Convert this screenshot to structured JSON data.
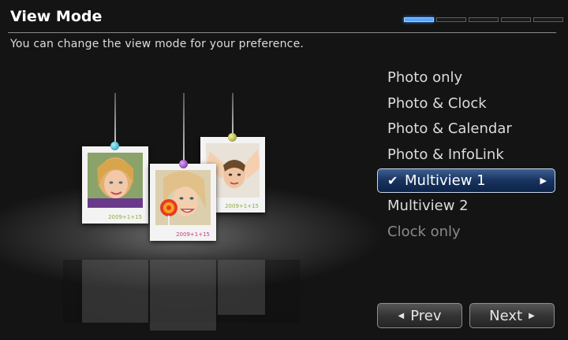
{
  "header": {
    "title": "View Mode",
    "subtitle": "You can change the view mode for your preference.",
    "steps_total": 5,
    "step_active": 1
  },
  "preview": {
    "photos": [
      {
        "caption": "2009+1+15"
      },
      {
        "caption": "2009+1+15"
      },
      {
        "caption": "2009+1+15"
      }
    ]
  },
  "menu": {
    "items": [
      {
        "label": "Photo only",
        "state": "normal"
      },
      {
        "label": "Photo & Clock",
        "state": "normal"
      },
      {
        "label": "Photo & Calendar",
        "state": "normal"
      },
      {
        "label": "Photo & InfoLink",
        "state": "normal"
      },
      {
        "label": "Multiview 1",
        "state": "selected"
      },
      {
        "label": "Multiview 2",
        "state": "normal"
      },
      {
        "label": "Clock only",
        "state": "disabled"
      }
    ],
    "check_glyph": "✔",
    "arrow_glyph": "▶"
  },
  "buttons": {
    "prev_label": "Prev",
    "next_label": "Next"
  },
  "colors": {
    "accent": "#5aa6ff",
    "selected_bg": "#18335e"
  }
}
